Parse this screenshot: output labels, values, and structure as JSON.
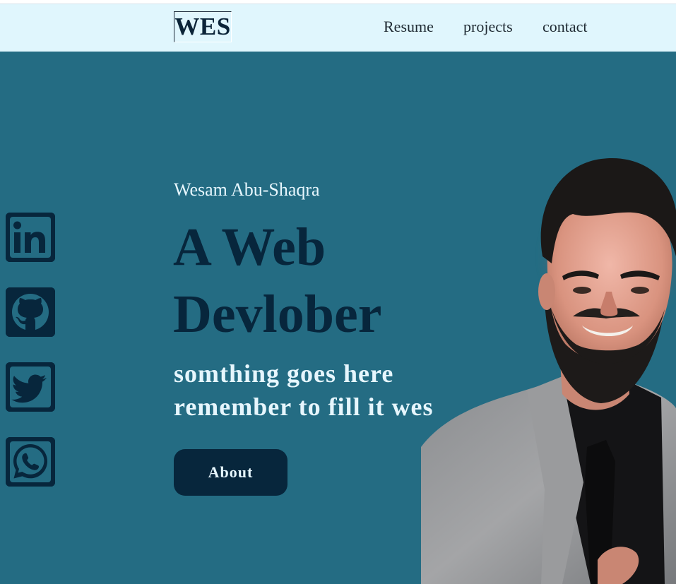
{
  "header": {
    "logo": "WES",
    "nav": [
      {
        "label": "Resume"
      },
      {
        "label": "projects"
      },
      {
        "label": "contact"
      }
    ]
  },
  "social": [
    {
      "icon": "linkedin-icon"
    },
    {
      "icon": "github-icon"
    },
    {
      "icon": "twitter-icon"
    },
    {
      "icon": "whatsapp-icon"
    }
  ],
  "hero": {
    "name": "Wesam Abu-Shaqra",
    "headline": "A Web Devlober",
    "tagline": "somthing goes here remember to fill it wes",
    "button_label": "About"
  },
  "colors": {
    "hero_bg": "#246c83",
    "nav_bg": "#e0f6fd",
    "dark": "#07263c",
    "light_text": "#e6f6fd"
  }
}
